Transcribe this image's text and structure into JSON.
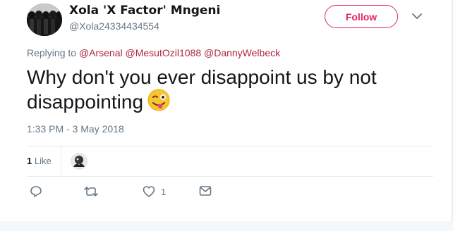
{
  "author": {
    "name": "Xola 'X Factor' Mngeni",
    "handle": "@Xola24334434554"
  },
  "follow_label": "Follow",
  "replying": {
    "prefix": "Replying to",
    "mentions": [
      "@Arsenal",
      "@MesutOzil1088",
      "@DannyWelbeck"
    ]
  },
  "tweet": {
    "text": "Why don't you ever disappoint us by not disappointing",
    "emoji": "winking-face-with-tongue",
    "timestamp": "1:33 PM - 3 May 2018"
  },
  "stats": {
    "likes_count": "1",
    "likes_label": "Like"
  },
  "actions": {
    "reply_count": "",
    "retweet_count": "",
    "like_count": "1"
  },
  "colors": {
    "accent": "#e0245e",
    "mention": "#b0263f",
    "muted": "#657786",
    "text": "#14171a"
  }
}
